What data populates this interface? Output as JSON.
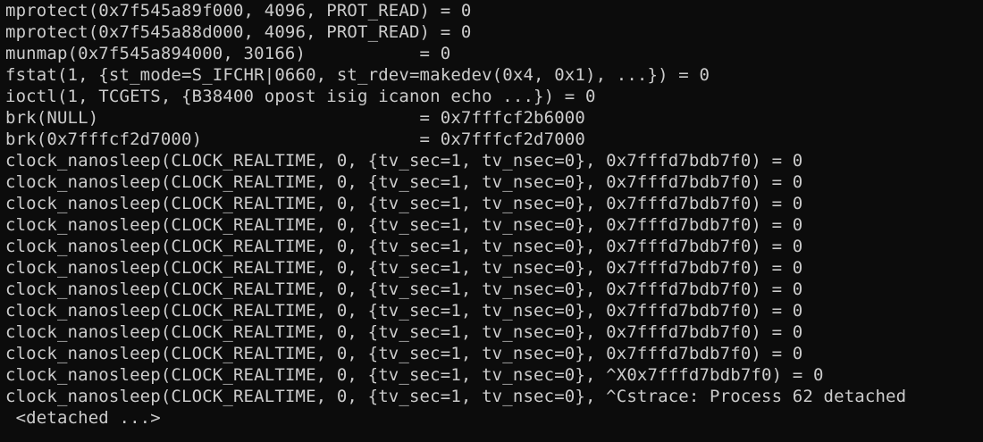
{
  "terminal": {
    "lines": [
      "mprotect(0x7f545a89f000, 4096, PROT_READ) = 0",
      "mprotect(0x7f545a88d000, 4096, PROT_READ) = 0",
      "munmap(0x7f545a894000, 30166)           = 0",
      "fstat(1, {st_mode=S_IFCHR|0660, st_rdev=makedev(0x4, 0x1), ...}) = 0",
      "ioctl(1, TCGETS, {B38400 opost isig icanon echo ...}) = 0",
      "brk(NULL)                               = 0x7fffcf2b6000",
      "brk(0x7fffcf2d7000)                     = 0x7fffcf2d7000",
      "clock_nanosleep(CLOCK_REALTIME, 0, {tv_sec=1, tv_nsec=0}, 0x7fffd7bdb7f0) = 0",
      "clock_nanosleep(CLOCK_REALTIME, 0, {tv_sec=1, tv_nsec=0}, 0x7fffd7bdb7f0) = 0",
      "clock_nanosleep(CLOCK_REALTIME, 0, {tv_sec=1, tv_nsec=0}, 0x7fffd7bdb7f0) = 0",
      "clock_nanosleep(CLOCK_REALTIME, 0, {tv_sec=1, tv_nsec=0}, 0x7fffd7bdb7f0) = 0",
      "clock_nanosleep(CLOCK_REALTIME, 0, {tv_sec=1, tv_nsec=0}, 0x7fffd7bdb7f0) = 0",
      "clock_nanosleep(CLOCK_REALTIME, 0, {tv_sec=1, tv_nsec=0}, 0x7fffd7bdb7f0) = 0",
      "clock_nanosleep(CLOCK_REALTIME, 0, {tv_sec=1, tv_nsec=0}, 0x7fffd7bdb7f0) = 0",
      "clock_nanosleep(CLOCK_REALTIME, 0, {tv_sec=1, tv_nsec=0}, 0x7fffd7bdb7f0) = 0",
      "clock_nanosleep(CLOCK_REALTIME, 0, {tv_sec=1, tv_nsec=0}, 0x7fffd7bdb7f0) = 0",
      "clock_nanosleep(CLOCK_REALTIME, 0, {tv_sec=1, tv_nsec=0}, 0x7fffd7bdb7f0) = 0",
      "clock_nanosleep(CLOCK_REALTIME, 0, {tv_sec=1, tv_nsec=0}, ^X0x7fffd7bdb7f0) = 0",
      "clock_nanosleep(CLOCK_REALTIME, 0, {tv_sec=1, tv_nsec=0}, ^Cstrace: Process 62 detached",
      " <detached ...>"
    ],
    "colors": {
      "background": "#0c0c0c",
      "foreground": "#cccccc"
    }
  }
}
